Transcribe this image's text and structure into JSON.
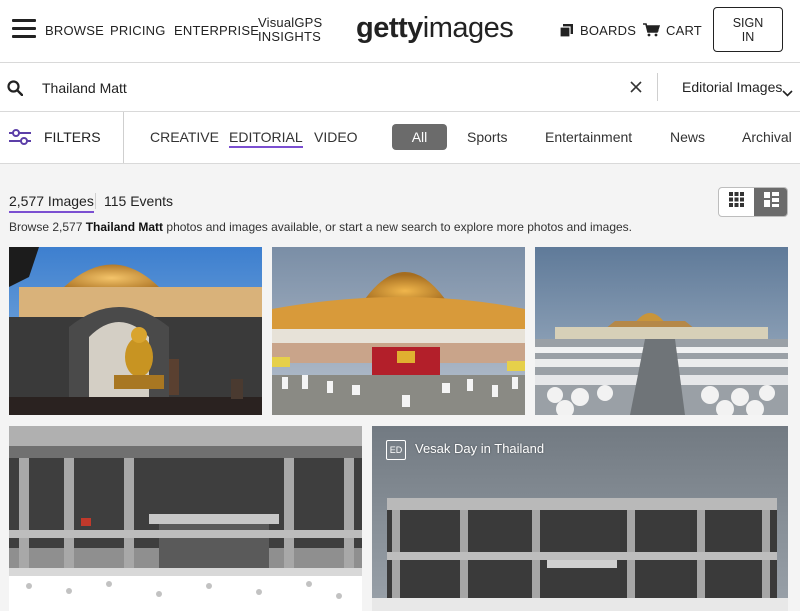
{
  "header": {
    "nav": [
      "BROWSE",
      "PRICING",
      "ENTERPRISE"
    ],
    "visualgps_line1": "VisualGPS",
    "visualgps_line2": "INSIGHTS",
    "logo_bold": "getty",
    "logo_light": "images",
    "boards": "BOARDS",
    "cart": "CART",
    "signin_line1": "SIGN",
    "signin_line2": "IN"
  },
  "search": {
    "query": "Thailand Matt",
    "scope": "Editorial Images"
  },
  "filters": {
    "label": "FILTERS",
    "tabs": [
      "CREATIVE",
      "EDITORIAL",
      "VIDEO"
    ],
    "active_tab": "EDITORIAL",
    "categories": [
      "All",
      "Sports",
      "Entertainment",
      "News",
      "Archival"
    ],
    "active_category": "All"
  },
  "results": {
    "images_count": "2,577 Images",
    "events_count": "115 Events",
    "browse_prefix": "Browse 2,577 ",
    "browse_query": "Thailand Matt",
    "browse_suffix": " photos and images available, or start a new search to explore more photos and images."
  },
  "images": [
    {
      "id": "buddha-dome",
      "desc": "golden buddha under dome"
    },
    {
      "id": "stupa-ceremony",
      "desc": "golden stupa with crowd"
    },
    {
      "id": "pilgrims-field",
      "desc": "white-robed pilgrims"
    },
    {
      "id": "hall-left",
      "desc": "grey hall with crowd"
    },
    {
      "id": "hall-right",
      "desc": "grey hall at dusk",
      "badge": "ED",
      "caption": "Vesak Day in Thailand"
    }
  ],
  "colors": {
    "accent": "#7b4fd1",
    "chip": "#6b6b6b"
  }
}
